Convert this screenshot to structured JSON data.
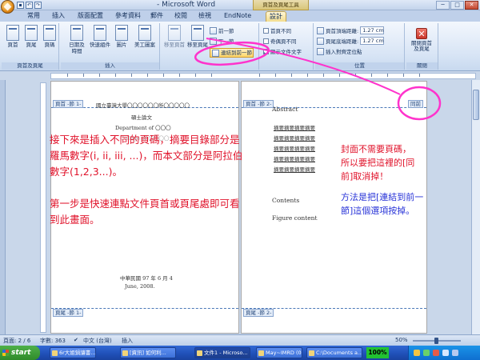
{
  "window": {
    "title": "- Microsoft Word",
    "context_tab_group": "頁首及頁尾工具",
    "qat_icons": [
      "save-icon",
      "undo-icon",
      "redo-icon"
    ],
    "min_label": "─",
    "max_label": "□",
    "close_label": "✕"
  },
  "tabs": [
    "常用",
    "插入",
    "版面配置",
    "參考資料",
    "郵件",
    "校閱",
    "檢視",
    "EndNote",
    "設計"
  ],
  "ribbon": {
    "header_footer_group": {
      "label": "頁首及頁尾",
      "buttons": [
        "頁首",
        "頁尾",
        "頁碼"
      ]
    },
    "insert_group": {
      "label": "插入",
      "buttons": [
        "日期及時間",
        "快速組件",
        "圖片",
        "美工圖案"
      ]
    },
    "navigation_group": {
      "buttons": [
        "移至頁首",
        "移至頁尾"
      ],
      "prev_label": "前一節",
      "next_label": "下一節",
      "link_previous_label": "連結到前一節"
    },
    "options_group": {
      "checkboxes": [
        {
          "label": "首頁不同",
          "checked": false
        },
        {
          "label": "奇偶頁不同",
          "checked": false
        },
        {
          "label": "顯示文件文字",
          "checked": true
        }
      ]
    },
    "position_group": {
      "label": "位置",
      "header_top_label": "頁首頂端距離:",
      "header_top_value": "1.27 cm",
      "footer_bottom_label": "頁尾底端距離:",
      "footer_bottom_value": "1.27 cm",
      "insert_align_tab_label": "插入對齊定位點"
    },
    "close_group": {
      "label": "關閉",
      "button": "關閉頁首及頁尾"
    }
  },
  "left_page": {
    "header_tag": "頁首 -節 1-",
    "footer_tag": "頁尾 -節 1-",
    "university": "國立臺灣大學〇〇〇〇〇〇所〇〇〇〇〇",
    "thesis_type": "碩士論文",
    "department": "Department of 〇〇〇",
    "college": "College of 〇〇〇〇",
    "date_zh": "中華民國 97 年 6 月 4",
    "date_en": "June, 2008."
  },
  "right_page": {
    "header_tag": "頁首 -節 2-",
    "footer_tag": "頁尾 -節 2-",
    "same_as_prev_tag": "同前",
    "abstract_heading": "Abstract",
    "abstract_lines": [
      "摘要摘要摘要摘要",
      "摘要摘要摘要摘要",
      "摘要摘要摘要摘要",
      "摘要摘要摘要摘要",
      "摘要摘要摘要摘要"
    ],
    "contents_heading": "Contents",
    "figure_heading": "Figure content"
  },
  "annotations": {
    "red_paragraph_1": "接下來是插入不同的頁碼，摘要目錄部分是羅馬數字(i, ii, iii, ...)，而本文部分是阿拉伯數字(1,2,3...)。",
    "red_paragraph_2": "第一步是快速連點文件頁首或頁尾處即可看到此畫面。",
    "red_right_lines": [
      "封面不需要頁碼，",
      "所以要把這裡的[同",
      "前]取消掉！"
    ],
    "blue_lines": [
      "方法是把[連結到前一",
      "節]這個選項按掉。"
    ],
    "red_color": "#e0122a",
    "blue_color": "#2a35d8",
    "highlight_color": "#ff33cc"
  },
  "statusbar": {
    "page": "頁面: 2 / 6",
    "words": "字數: 363",
    "language": "中文 (台灣)",
    "mode": "插入",
    "zoom": "50%"
  },
  "taskbar": {
    "start": "start",
    "tasks": [
      "6r大姐鍋讓書...",
      "[資訊] 如何利...",
      "文件1 - Microso...",
      "May~IMRD (06...",
      "C:\\Documents a..."
    ],
    "zoom_badge": "100%"
  }
}
